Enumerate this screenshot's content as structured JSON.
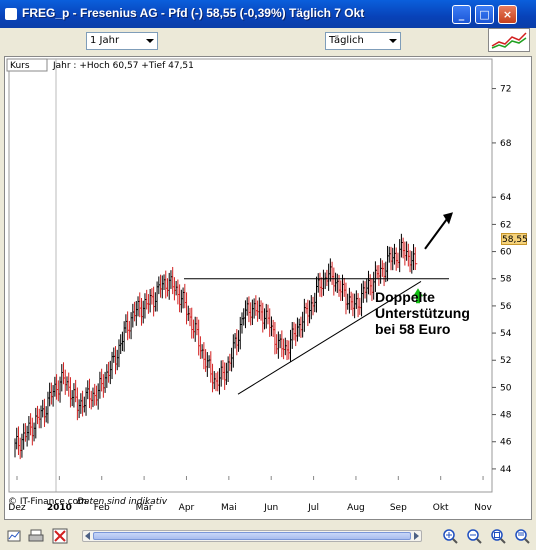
{
  "window": {
    "title": "FREG_p - Fresenius AG - Pfd (-)    58,55 (-0,39%)    Täglich  7 Okt",
    "buttons": [
      "_",
      "□",
      "×"
    ]
  },
  "toolbar": {
    "period": "1 Jahr",
    "interval": "Täglich"
  },
  "chart": {
    "panel_label": "Kurs",
    "range_info": "Jahr : +Hoch 60,57 +Tief 47,51",
    "source": "© IT-Finance.com",
    "disclaimer": "Daten sind indikativ",
    "last_price": "58,55",
    "annotation": [
      "Doppelte",
      "Unterstützung",
      "bei 58 Euro"
    ]
  },
  "chart_data": {
    "type": "ohlc",
    "x_labels": [
      "Dez",
      "2010",
      "Feb",
      "Mär",
      "Apr",
      "Mai",
      "Jun",
      "Jul",
      "Aug",
      "Sep",
      "Okt",
      "Nov"
    ],
    "y_ticks": [
      44,
      46,
      48,
      50,
      52,
      54,
      56,
      58,
      60,
      62,
      64,
      68,
      72
    ],
    "ylim": [
      42.3,
      73
    ],
    "support_level": 58,
    "trendline": {
      "from": [
        "Mai",
        49.5
      ],
      "to": [
        "Okt",
        57.8
      ]
    },
    "series_close": [
      45.6,
      46.2,
      46.8,
      47.5,
      48.1,
      49.2,
      50.1,
      50.6,
      49.8,
      48.6,
      49.1,
      49.4,
      49.6,
      50.8,
      51.6,
      52.9,
      54.3,
      55.3,
      55.9,
      56.1,
      56.6,
      57.4,
      57.8,
      57.3,
      56.6,
      55.4,
      54.1,
      52.6,
      51.3,
      50.4,
      50.9,
      51.9,
      53.6,
      55.3,
      55.9,
      55.6,
      55.4,
      54.3,
      53.1,
      52.8,
      53.6,
      54.6,
      55.4,
      56.3,
      57.6,
      58.2,
      58.1,
      57.1,
      56.6,
      55.8,
      56.8,
      57.4,
      58.1,
      58.6,
      59.4,
      59.7,
      60.1,
      59.6,
      58.6
    ],
    "colors": {
      "up": "#000000",
      "down": "#d22020",
      "lines": "#000000",
      "arrow_up": "#10c010"
    }
  },
  "icons": [
    "print-icon",
    "delete-icon",
    "zoom-in-icon",
    "zoom-out-icon",
    "zoom-reset-icon"
  ]
}
